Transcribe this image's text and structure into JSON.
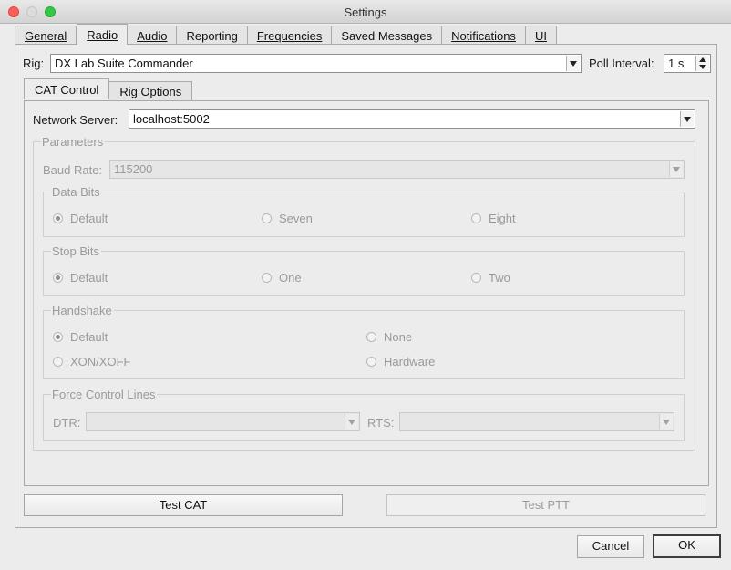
{
  "window": {
    "title": "Settings"
  },
  "tabs": [
    "General",
    "Radio",
    "Audio",
    "Reporting",
    "Frequencies",
    "Saved Messages",
    "Notifications",
    "UI"
  ],
  "rig": {
    "label": "Rig:",
    "value": "DX Lab Suite Commander"
  },
  "poll": {
    "label": "Poll Interval:",
    "value": "1 s"
  },
  "subtabs": [
    "CAT Control",
    "Rig Options"
  ],
  "network": {
    "label": "Network Server:",
    "value": "localhost:5002"
  },
  "parameters": {
    "title": "Parameters",
    "baud": {
      "label": "Baud Rate:",
      "value": "115200"
    },
    "data_bits": {
      "title": "Data Bits",
      "options": [
        "Default",
        "Seven",
        "Eight"
      ],
      "selected": "Default"
    },
    "stop_bits": {
      "title": "Stop Bits",
      "options": [
        "Default",
        "One",
        "Two"
      ],
      "selected": "Default"
    },
    "handshake": {
      "title": "Handshake",
      "options": [
        "Default",
        "None",
        "XON/XOFF",
        "Hardware"
      ],
      "selected": "Default"
    },
    "force": {
      "title": "Force Control Lines",
      "dtr_label": "DTR:",
      "rts_label": "RTS:"
    }
  },
  "buttons": {
    "test_cat": "Test CAT",
    "test_ptt": "Test PTT",
    "cancel": "Cancel",
    "ok": "OK"
  }
}
